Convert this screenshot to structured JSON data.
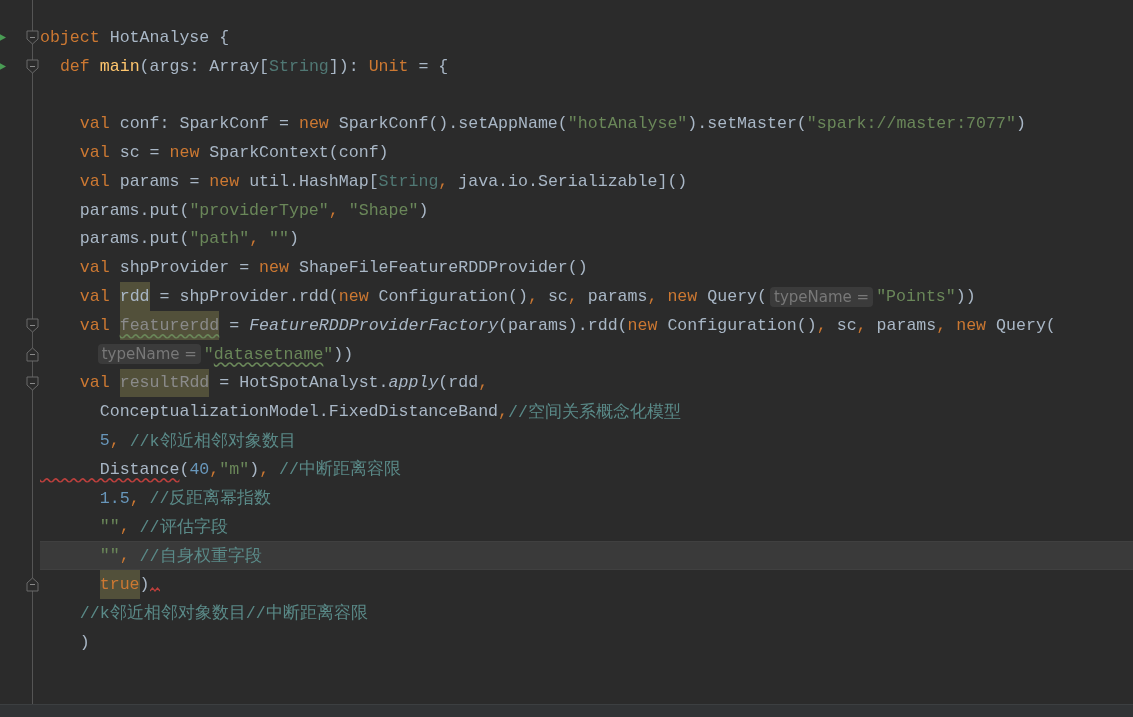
{
  "editor": {
    "lines": [
      {
        "run": true,
        "fold_start": true,
        "current": false,
        "tokens": [
          {
            "text": "object",
            "kind": "kw"
          },
          {
            "text": " HotAnalyse {",
            "kind": "plain"
          }
        ]
      },
      {
        "run": true,
        "fold_start": true,
        "current": false,
        "tokens": [
          {
            "text": "  def",
            "kind": "kw"
          },
          {
            "text": " main",
            "kind": "fn"
          },
          {
            "text": "(args: Array[",
            "kind": "plain"
          },
          {
            "text": "String",
            "kind": "type"
          },
          {
            "text": "]): ",
            "kind": "plain"
          },
          {
            "text": "Unit",
            "kind": "kw"
          },
          {
            "text": " = {",
            "kind": "plain"
          }
        ]
      },
      {
        "current": false
      },
      {
        "current": false,
        "tokens": [
          {
            "text": "    val",
            "kind": "kw"
          },
          {
            "text": " conf: SparkConf = ",
            "kind": "plain"
          },
          {
            "text": "new",
            "kind": "kw"
          },
          {
            "text": " SparkConf().setAppName(",
            "kind": "plain"
          },
          {
            "text": "\"hotAnalyse\"",
            "kind": "str"
          },
          {
            "text": ").setMaster(",
            "kind": "plain"
          },
          {
            "text": "\"spark://master:7077\"",
            "kind": "str"
          },
          {
            "text": ")",
            "kind": "plain"
          }
        ]
      },
      {
        "current": false,
        "tokens": [
          {
            "text": "    val",
            "kind": "kw"
          },
          {
            "text": " sc = ",
            "kind": "plain"
          },
          {
            "text": "new",
            "kind": "kw"
          },
          {
            "text": " SparkContext(conf)",
            "kind": "plain"
          }
        ]
      },
      {
        "current": false,
        "tokens": [
          {
            "text": "    val",
            "kind": "kw"
          },
          {
            "text": " params = ",
            "kind": "plain"
          },
          {
            "text": "new",
            "kind": "kw"
          },
          {
            "text": " util.HashMap[",
            "kind": "plain"
          },
          {
            "text": "String",
            "kind": "type"
          },
          {
            "text": ",",
            "kind": "punct"
          },
          {
            "text": " java.io.Serializable]()",
            "kind": "plain"
          }
        ]
      },
      {
        "current": false,
        "tokens": [
          {
            "text": "    params.put(",
            "kind": "plain"
          },
          {
            "text": "\"providerType\"",
            "kind": "str"
          },
          {
            "text": ",",
            "kind": "punct"
          },
          {
            "text": " \"Shape\"",
            "kind": "str"
          },
          {
            "text": ")",
            "kind": "plain"
          }
        ]
      },
      {
        "current": false,
        "tokens": [
          {
            "text": "    params.put(",
            "kind": "plain"
          },
          {
            "text": "\"path\"",
            "kind": "str"
          },
          {
            "text": ",",
            "kind": "punct"
          },
          {
            "text": " \"\"",
            "kind": "str"
          },
          {
            "text": ")",
            "kind": "plain"
          }
        ]
      },
      {
        "current": false,
        "tokens": [
          {
            "text": "    val",
            "kind": "kw"
          },
          {
            "text": " shpProvider = ",
            "kind": "plain"
          },
          {
            "text": "new",
            "kind": "kw"
          },
          {
            "text": " ShapeFileFeatureRDDProvider()",
            "kind": "plain"
          }
        ]
      },
      {
        "current": false,
        "tokens": [
          {
            "text": "    val ",
            "kind": "kw"
          },
          {
            "text": "rdd",
            "kind": "plain",
            "highlighted": true
          },
          {
            "text": " = shpProvider.rdd(",
            "kind": "plain"
          },
          {
            "text": "new",
            "kind": "kw"
          },
          {
            "text": " Configuration()",
            "kind": "plain"
          },
          {
            "text": ",",
            "kind": "punct"
          },
          {
            "text": " sc",
            "kind": "plain"
          },
          {
            "text": ",",
            "kind": "punct"
          },
          {
            "text": " params",
            "kind": "plain"
          },
          {
            "text": ",",
            "kind": "punct"
          },
          {
            "text": " new",
            "kind": "kw"
          },
          {
            "text": " Query(",
            "kind": "plain"
          },
          {
            "text": "typeName =",
            "kind": "hint"
          },
          {
            "text": "\"Points\"",
            "kind": "str"
          },
          {
            "text": "))",
            "kind": "plain"
          }
        ]
      },
      {
        "fold_start": true,
        "current": false,
        "tokens": [
          {
            "text": "    val ",
            "kind": "kw"
          },
          {
            "text": "featurerdd",
            "kind": "unused",
            "highlighted": true,
            "warning": true
          },
          {
            "text": " = ",
            "kind": "plain"
          },
          {
            "text": "FeatureRDDProviderFactory",
            "kind": "italic"
          },
          {
            "text": "(params).rdd(",
            "kind": "plain"
          },
          {
            "text": "new",
            "kind": "kw"
          },
          {
            "text": " Configuration()",
            "kind": "plain"
          },
          {
            "text": ",",
            "kind": "punct"
          },
          {
            "text": " sc",
            "kind": "plain"
          },
          {
            "text": ",",
            "kind": "punct"
          },
          {
            "text": " params",
            "kind": "plain"
          },
          {
            "text": ",",
            "kind": "punct"
          },
          {
            "text": " new",
            "kind": "kw"
          },
          {
            "text": " Query(",
            "kind": "plain"
          }
        ]
      },
      {
        "fold_end": true,
        "current": false,
        "continuation": true,
        "tokens": [
          {
            "text": "typeName =",
            "kind": "hint"
          },
          {
            "text": "\"",
            "kind": "str"
          },
          {
            "text": "datasetname",
            "kind": "str",
            "warning": true
          },
          {
            "text": "\"",
            "kind": "str"
          },
          {
            "text": "))",
            "kind": "plain"
          }
        ]
      },
      {
        "fold_start": true,
        "current": false,
        "tokens": [
          {
            "text": "    val ",
            "kind": "kw"
          },
          {
            "text": "resultRdd",
            "kind": "unused",
            "highlighted": true
          },
          {
            "text": " = HotSpotAnalyst.",
            "kind": "plain"
          },
          {
            "text": "apply",
            "kind": "italic"
          },
          {
            "text": "(rdd",
            "kind": "plain"
          },
          {
            "text": ",",
            "kind": "punct"
          }
        ]
      },
      {
        "current": false,
        "tokens": [
          {
            "text": "      ConceptualizationModel.FixedDistanceBand",
            "kind": "plain"
          },
          {
            "text": ",",
            "kind": "punct"
          },
          {
            "text": "//空间关系概念化模型",
            "kind": "comment"
          }
        ]
      },
      {
        "current": false,
        "tokens": [
          {
            "text": "      5",
            "kind": "num"
          },
          {
            "text": ",",
            "kind": "punct"
          },
          {
            "text": " //k邻近相邻对象数目",
            "kind": "comment"
          }
        ]
      },
      {
        "current": false,
        "tokens": [
          {
            "text": "      Distance",
            "kind": "plain",
            "error": true
          },
          {
            "text": "(",
            "kind": "plain"
          },
          {
            "text": "40",
            "kind": "num"
          },
          {
            "text": ",",
            "kind": "punct"
          },
          {
            "text": "\"m\"",
            "kind": "str"
          },
          {
            "text": ")",
            "kind": "plain"
          },
          {
            "text": ",",
            "kind": "punct"
          },
          {
            "text": " //中断距离容限",
            "kind": "comment"
          }
        ]
      },
      {
        "current": false,
        "tokens": [
          {
            "text": "      1.5",
            "kind": "num"
          },
          {
            "text": ",",
            "kind": "punct"
          },
          {
            "text": " //反距离幂指数",
            "kind": "comment"
          }
        ]
      },
      {
        "current": false,
        "tokens": [
          {
            "text": "      \"\"",
            "kind": "str"
          },
          {
            "text": ",",
            "kind": "punct"
          },
          {
            "text": " //评估字段",
            "kind": "comment"
          }
        ]
      },
      {
        "current": true,
        "tokens": [
          {
            "text": "      \"\"",
            "kind": "str"
          },
          {
            "text": ",",
            "kind": "punct"
          },
          {
            "text": " //自身权重字段",
            "kind": "comment"
          }
        ]
      },
      {
        "fold_end": true,
        "current": false,
        "error_mark": true,
        "continuation": true,
        "tokens": [
          {
            "text": "true",
            "kind": "kw",
            "highlighted": true
          },
          {
            "text": ")",
            "kind": "plain"
          }
        ]
      },
      {
        "current": false,
        "tokens": [
          {
            "text": "    //k邻近相邻对象数目//中断距离容限",
            "kind": "comment"
          }
        ]
      },
      {
        "current": false,
        "tokens": [
          {
            "text": "    )",
            "kind": "plain"
          }
        ]
      }
    ]
  }
}
